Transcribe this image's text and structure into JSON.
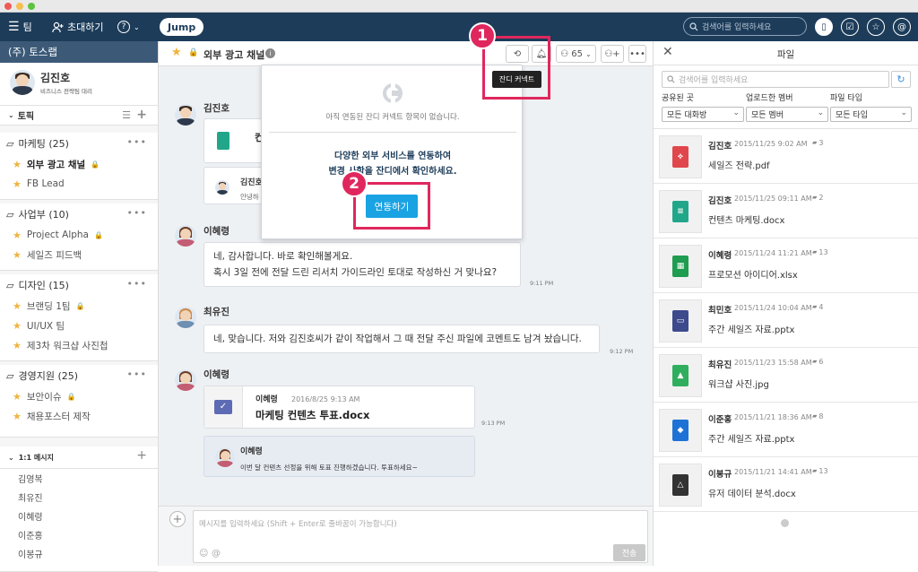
{
  "topbar": {
    "team_label": "팀",
    "invite_label": "초대하기",
    "jump_label": "Jump",
    "search_placeholder": "검색어를 입력하세요"
  },
  "sidebar": {
    "team_name": "(주) 토스랩",
    "profile": {
      "name": "김진호",
      "title": "비즈니스 전략팀 대리"
    },
    "topics_header": "토픽",
    "groups": [
      {
        "name": "마케팅 (25)",
        "channels": [
          {
            "name": "외부 광고 채널",
            "lock": true,
            "bold": true
          },
          {
            "name": "FB Lead",
            "lock": false
          }
        ]
      },
      {
        "name": "사업부 (10)",
        "channels": [
          {
            "name": "Project Alpha",
            "lock": true
          },
          {
            "name": "세일즈 피드백",
            "lock": false
          }
        ]
      },
      {
        "name": "디자인 (15)",
        "channels": [
          {
            "name": "브랜딩 1팀",
            "lock": true
          },
          {
            "name": "UI/UX 팀",
            "lock": false
          },
          {
            "name": "제3차 워크샵 사진첩",
            "lock": false
          }
        ]
      },
      {
        "name": "경영지원 (25)",
        "channels": [
          {
            "name": "보안이슈",
            "lock": true
          },
          {
            "name": "채용포스터 제작",
            "lock": false
          }
        ]
      }
    ],
    "dm_header": "1:1 메시지",
    "dms": [
      "김영복",
      "최유진",
      "이혜령",
      "이준홍",
      "이봉규"
    ]
  },
  "channel": {
    "title": "외부 광고 채널",
    "member_count": "65",
    "tooltip": "잔디 커넥트"
  },
  "popup": {
    "empty_text": "아직 연동된 잔디 커넥트 항목이 없습니다.",
    "line1": "다양한 외부 서비스를 연동하여",
    "line2": "변경 사항을 잔디에서 확인하세요.",
    "button": "연동하기"
  },
  "badges": {
    "one": "1",
    "two": "2"
  },
  "messages": {
    "m1": {
      "name": "김진호",
      "file_initial": "컨",
      "reply_name": "김진호",
      "reply_text": "안녕하"
    },
    "m2": {
      "name": "이혜령",
      "line1": "네, 감사합니다. 바로 확인해볼게요.",
      "line2": "혹시 3일 전에 전달 드린 리서치 가이드라인 토대로 작성하신 거 맞나요?",
      "time": "9:11 PM"
    },
    "m3": {
      "name": "최유진",
      "text": "네, 맞습니다. 저와 김진호씨가 같이 작업해서 그 때 전달 주신 파일에 코멘트도 남겨 놨습니다.",
      "time": "9:12 PM"
    },
    "m4": {
      "name": "이혜령",
      "file_author": "이혜령",
      "file_date": "2016/8/25 9:13 AM",
      "file_name": "마케팅 컨텐츠 투표.docx",
      "time": "9:13 PM",
      "comment_name": "이혜령",
      "comment_text": "이번 달 컨텐츠 선정을 위해 토표 진행하겠습니다. 투표하세요~"
    }
  },
  "composer": {
    "placeholder": "메시지를 입력하세요 (Shift + Enter로 줄바꿈이 가능합니다)",
    "send": "전송"
  },
  "files_panel": {
    "title": "파일",
    "search_placeholder": "검색어를 입력하세요",
    "filters": [
      {
        "label": "공유된 곳",
        "value": "모든 대화방"
      },
      {
        "label": "업로드한 멤버",
        "value": "모든 멤버"
      },
      {
        "label": "파일 타입",
        "value": "모든 타입"
      }
    ],
    "files": [
      {
        "author": "김진호",
        "date": "2015/11/25 9:02 AM",
        "comments": "3",
        "name": "세일즈 전략.pdf",
        "type": "pdf",
        "color": "#e0474c"
      },
      {
        "author": "김진호",
        "date": "2015/11/25 09:11 AM",
        "comments": "2",
        "name": "컨텐츠 마케팅.docx",
        "type": "doc",
        "color": "#22a68a"
      },
      {
        "author": "이혜령",
        "date": "2015/11/24 11:21 AM",
        "comments": "13",
        "name": "프로모션 아이디어.xlsx",
        "type": "xls",
        "color": "#1e9c50"
      },
      {
        "author": "최민호",
        "date": "2015/11/24 10:04 AM",
        "comments": "4",
        "name": "주간 세일즈 자료.pptx",
        "type": "ppt",
        "color": "#3d4a8c"
      },
      {
        "author": "최유진",
        "date": "2015/11/23 15:58 AM",
        "comments": "6",
        "name": "워크샵 사진.jpg",
        "type": "img",
        "color": "#2fae5e"
      },
      {
        "author": "이준홍",
        "date": "2015/11/21 18:36 AM",
        "comments": "8",
        "name": "주간 세일즈 자료.pptx",
        "type": "dbx",
        "color": "#1e72d6"
      },
      {
        "author": "이봉규",
        "date": "2015/11/21 14:41 AM",
        "comments": "13",
        "name": "유저 데이터 분석.docx",
        "type": "gdr",
        "color": "#333333"
      }
    ]
  }
}
